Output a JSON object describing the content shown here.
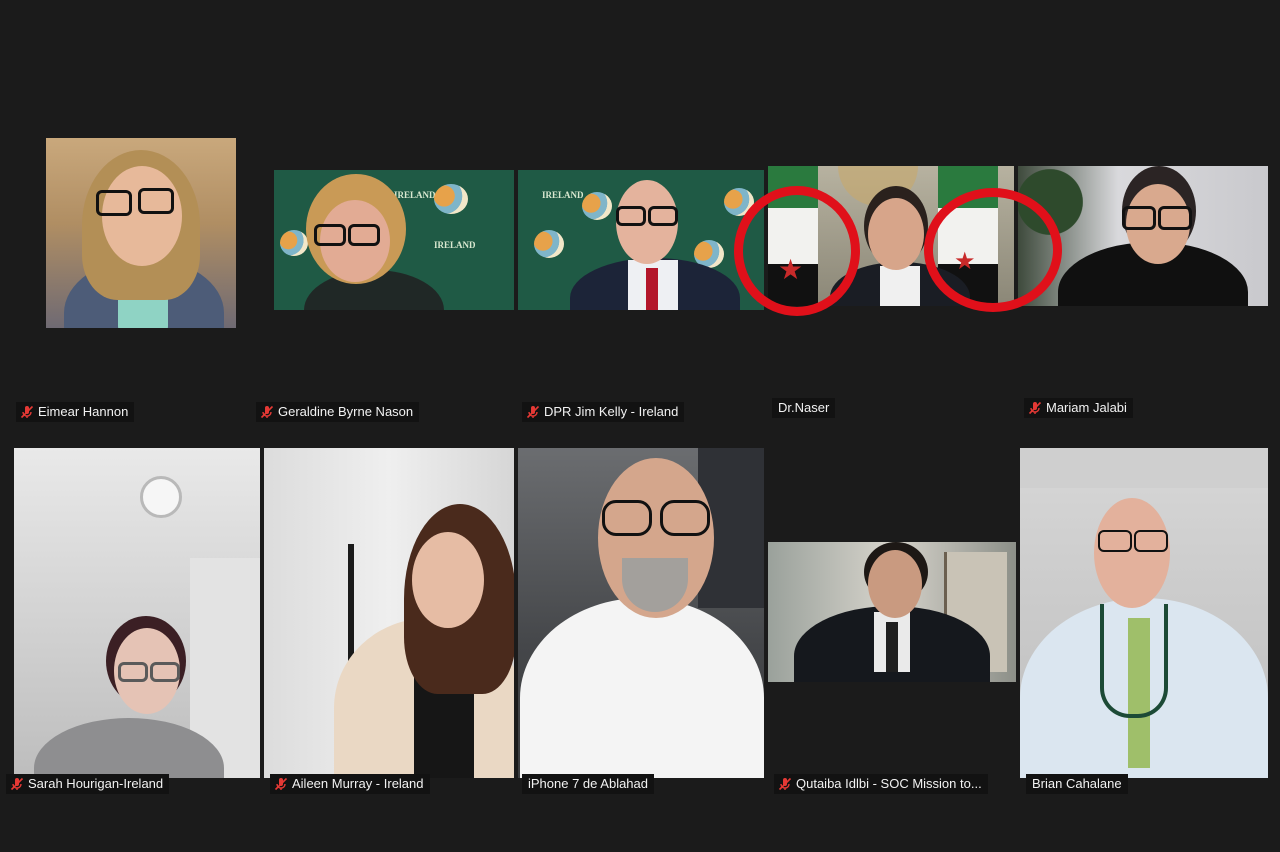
{
  "participants": [
    {
      "id": "eimear",
      "name": "Eimear Hannon",
      "muted": true
    },
    {
      "id": "geraldine",
      "name": "Geraldine Byrne Nason",
      "muted": true
    },
    {
      "id": "jim",
      "name": "DPR Jim Kelly - Ireland",
      "muted": true
    },
    {
      "id": "naser",
      "name": "Dr.Naser",
      "muted": false
    },
    {
      "id": "mariam",
      "name": "Mariam Jalabi",
      "muted": true
    },
    {
      "id": "sarah",
      "name": "Sarah Hourigan-Ireland",
      "muted": true
    },
    {
      "id": "aileen",
      "name": "Aileen Murray - Ireland",
      "muted": true
    },
    {
      "id": "iphone",
      "name": "iPhone 7 de Ablahad",
      "muted": false
    },
    {
      "id": "qutaiba",
      "name": "Qutaiba Idlbi - SOC Mission to...",
      "muted": true
    },
    {
      "id": "brian",
      "name": "Brian Cahalane",
      "muted": false
    }
  ],
  "backdrop_text": "IRELAND",
  "colors": {
    "background": "#1b1b1b",
    "name_tag_bg": "#121212",
    "mute_icon": "#e53935",
    "annotation_circle": "#e0101a",
    "ireland_backdrop": "#1f5a45"
  }
}
